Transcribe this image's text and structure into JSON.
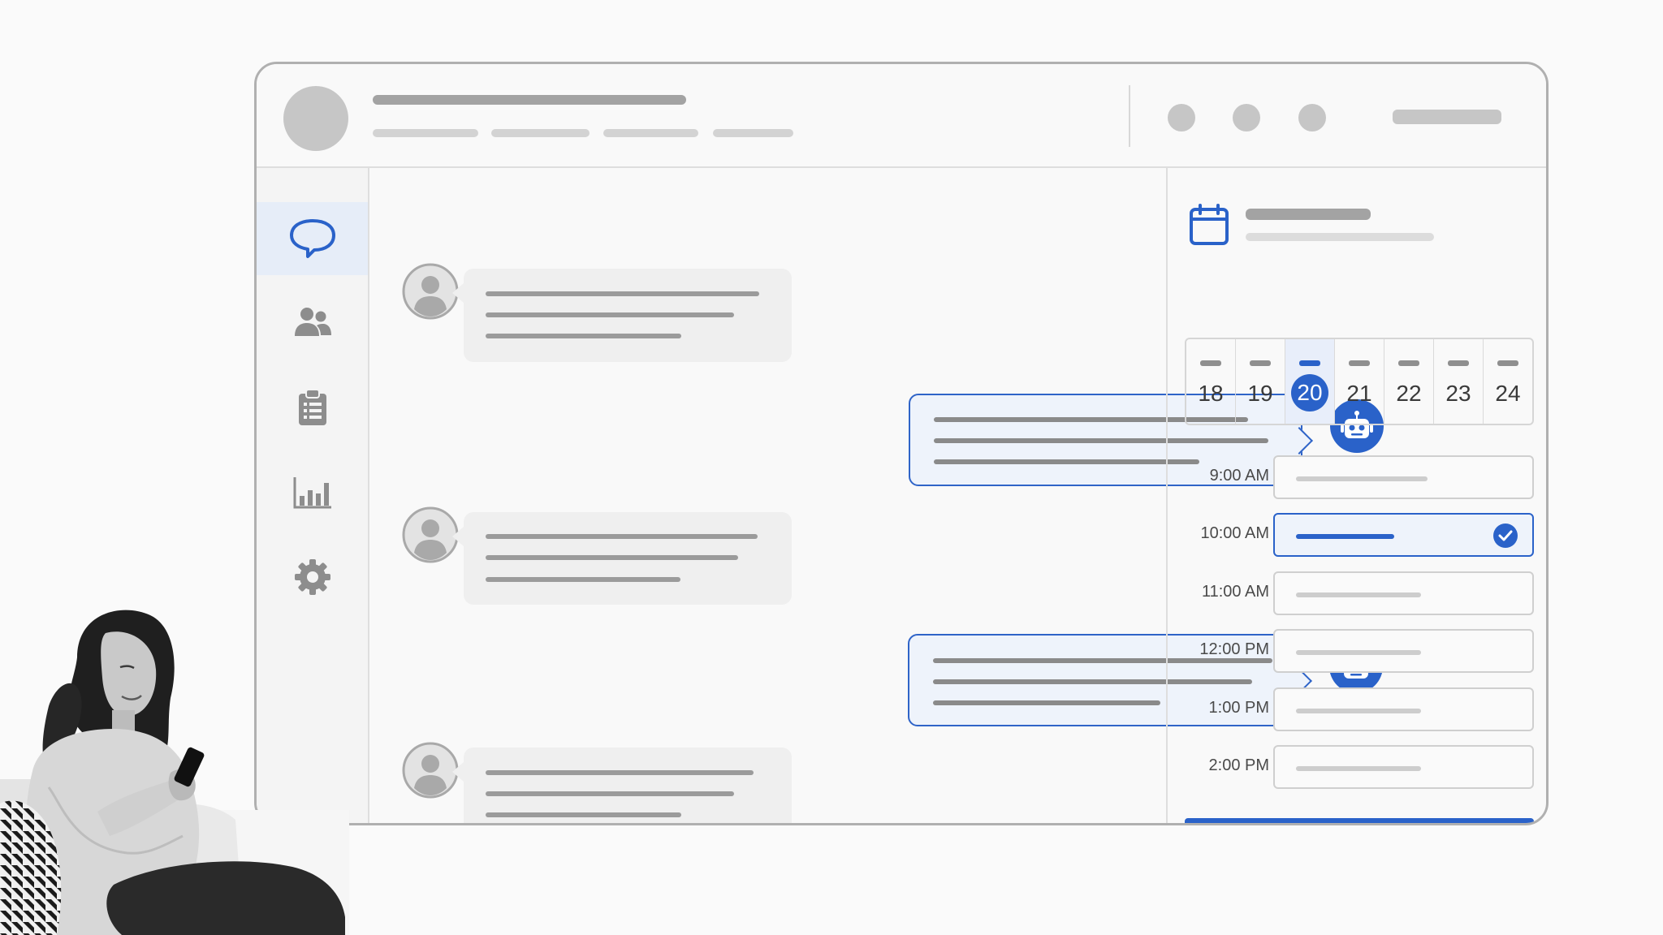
{
  "calendar": {
    "days": [
      {
        "label": "18",
        "selected": false
      },
      {
        "label": "19",
        "selected": false
      },
      {
        "label": "20",
        "selected": true
      },
      {
        "label": "21",
        "selected": false
      },
      {
        "label": "22",
        "selected": false
      },
      {
        "label": "23",
        "selected": false
      },
      {
        "label": "24",
        "selected": false
      }
    ],
    "selected_day": "20"
  },
  "time_slots": [
    {
      "time": "9:00 AM",
      "selected": false
    },
    {
      "time": "10:00 AM",
      "selected": true
    },
    {
      "time": "11:00 AM",
      "selected": false
    },
    {
      "time": "12:00 PM",
      "selected": false
    },
    {
      "time": "1:00 PM",
      "selected": false
    },
    {
      "time": "2:00 PM",
      "selected": false
    }
  ],
  "sidebar": {
    "items": [
      {
        "icon": "chat-bubble-icon",
        "active": true
      },
      {
        "icon": "users-icon",
        "active": false
      },
      {
        "icon": "clipboard-icon",
        "active": false
      },
      {
        "icon": "bar-chart-icon",
        "active": false
      },
      {
        "icon": "gear-icon",
        "active": false
      }
    ]
  },
  "colors": {
    "accent": "#2a62c9",
    "accent_light": "#eef3fb",
    "placeholder": "#c6c6c6"
  }
}
